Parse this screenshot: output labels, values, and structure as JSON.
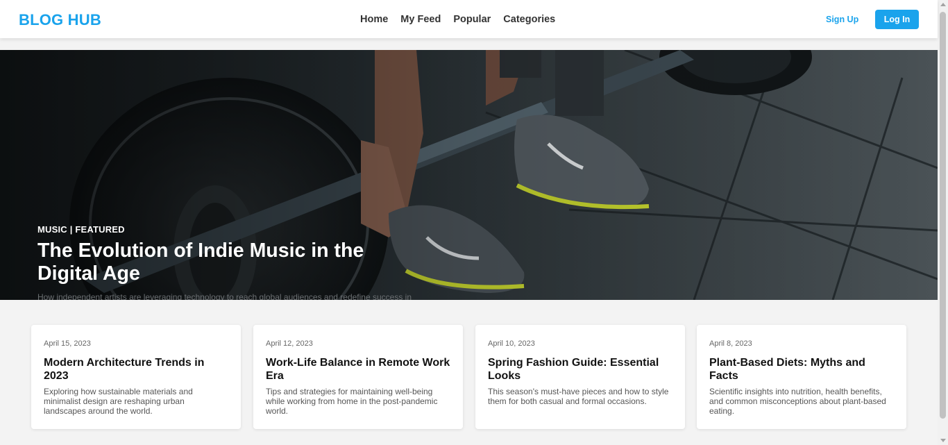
{
  "header": {
    "logo": "BLOG HUB",
    "nav": [
      "Home",
      "My Feed",
      "Popular",
      "Categories"
    ],
    "signup_label": "Sign Up",
    "login_label": "Log In"
  },
  "hero": {
    "category": "MUSIC | FEATURED",
    "title": "The Evolution of Indie Music in the Digital Age",
    "excerpt": "How independent artists are leveraging technology to reach global audiences and redefine success in the music industry.",
    "image": "weightlifting-barbell-photo"
  },
  "cards": [
    {
      "date": "April 15, 2023",
      "title": "Modern Architecture Trends in 2023",
      "excerpt": "Exploring how sustainable materials and minimalist design are reshaping urban landscapes around the world."
    },
    {
      "date": "April 12, 2023",
      "title": "Work-Life Balance in Remote Work Era",
      "excerpt": "Tips and strategies for maintaining well-being while working from home in the post-pandemic world."
    },
    {
      "date": "April 10, 2023",
      "title": "Spring Fashion Guide: Essential Looks",
      "excerpt": "This season's must-have pieces and how to style them for both casual and formal occasions."
    },
    {
      "date": "April 8, 2023",
      "title": "Plant-Based Diets: Myths and Facts",
      "excerpt": "Scientific insights into nutrition, health benefits, and common misconceptions about plant-based eating."
    }
  ],
  "colors": {
    "accent": "#1aa3ec",
    "background": "#f3f3f3",
    "card": "#ffffff"
  }
}
